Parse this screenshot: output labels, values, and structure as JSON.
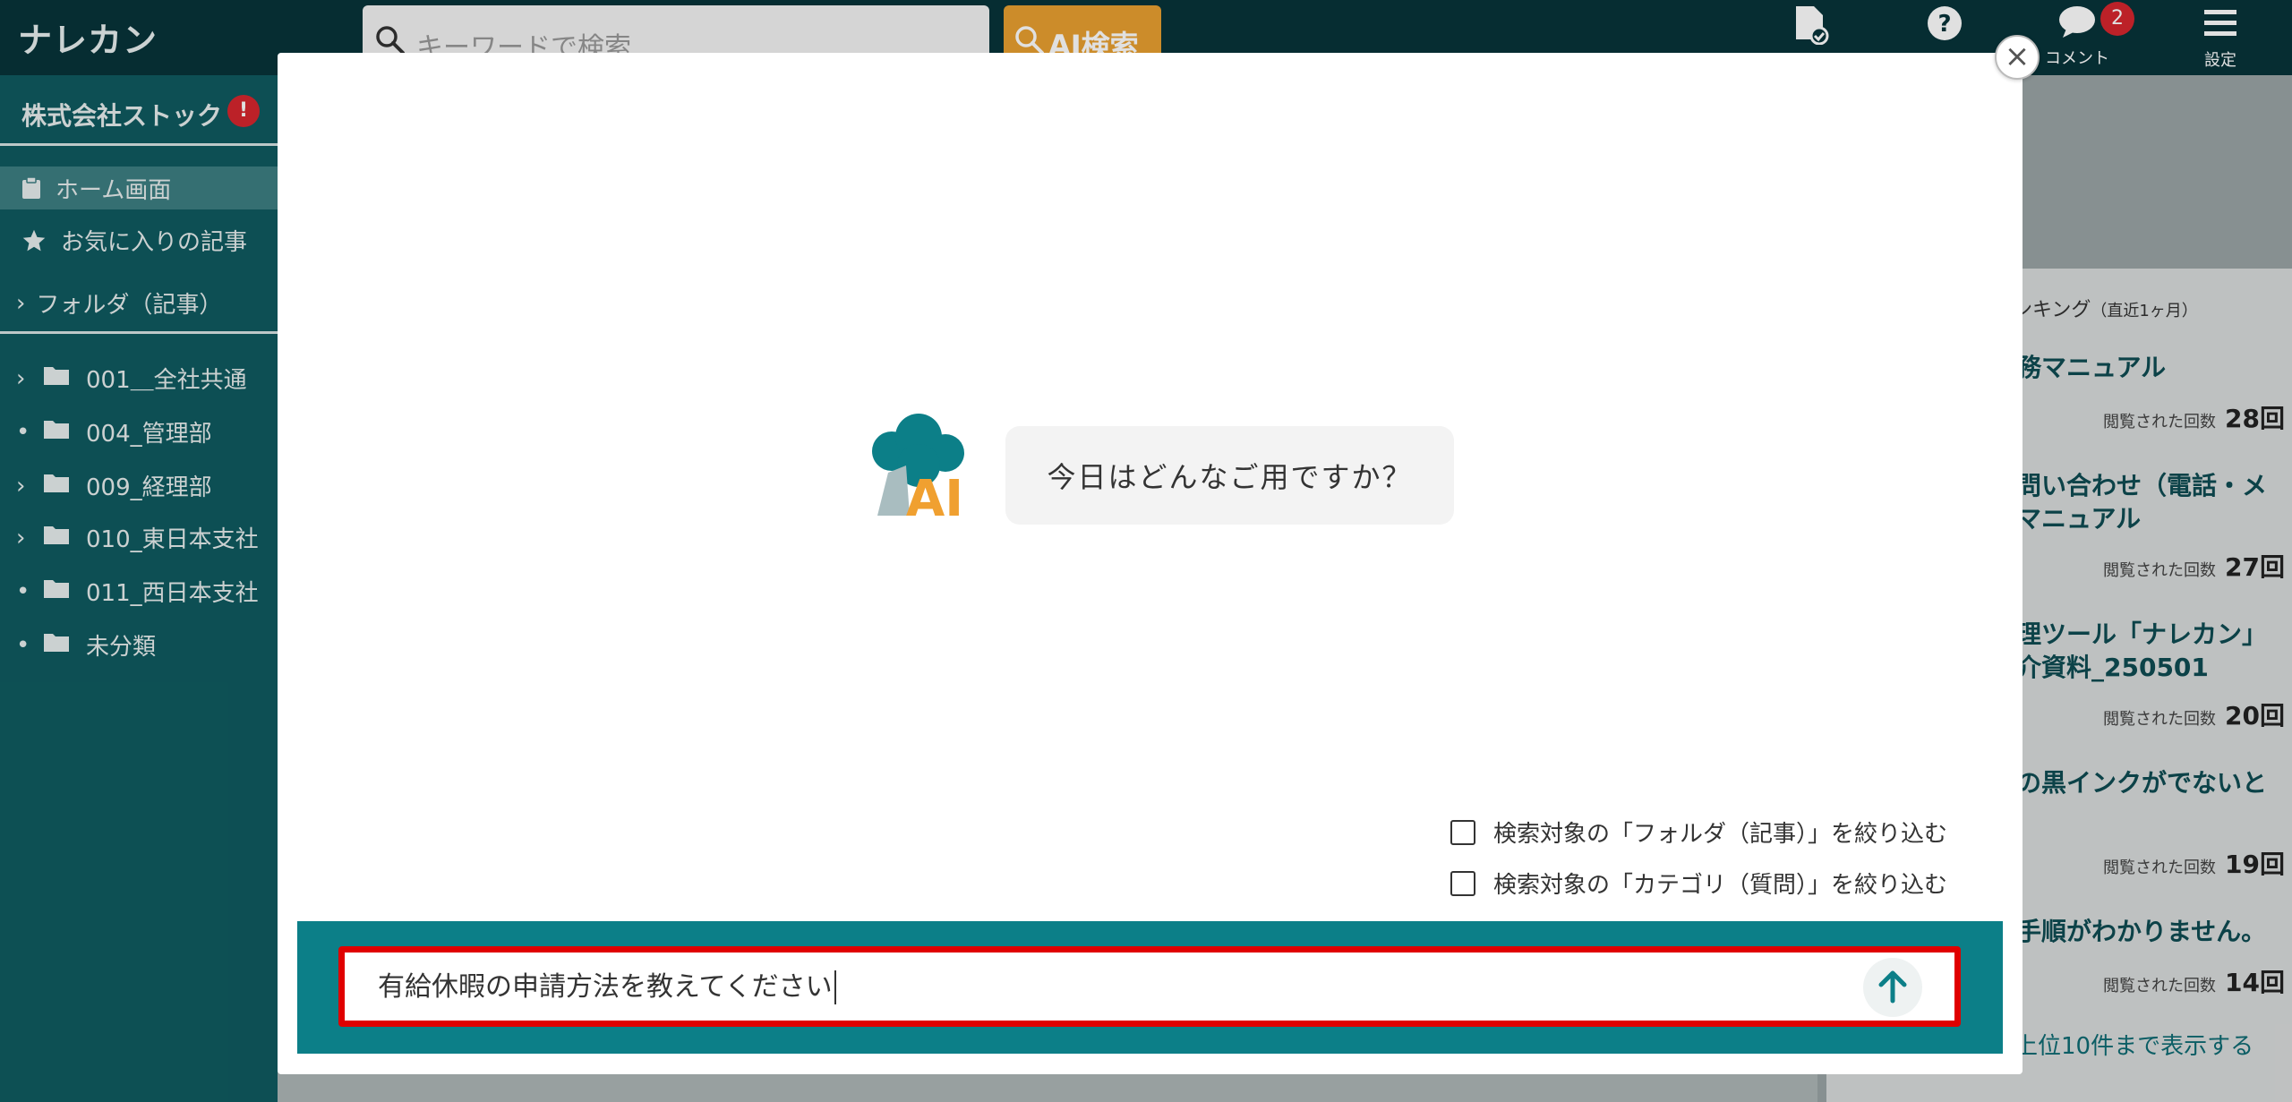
{
  "header": {
    "logo": "ナレカン",
    "search_placeholder": "キーワードで検索",
    "ai_search_label": "AI検索",
    "comment_label": "コメント",
    "comment_badge": "2",
    "settings_label": "設定"
  },
  "sidebar": {
    "company": "株式会社ストック",
    "company_alert": "!",
    "home": "ホーム画面",
    "favorites": "お気に入りの記事",
    "folder_section": "フォルダ（記事）",
    "folders": [
      {
        "label": "001＿全社共通",
        "expandable": true
      },
      {
        "label": "004_管理部",
        "expandable": false
      },
      {
        "label": "009_経理部",
        "expandable": true
      },
      {
        "label": "010_東日本支社",
        "expandable": true
      },
      {
        "label": "011_西日本支社",
        "expandable": false
      },
      {
        "label": "未分類",
        "expandable": false
      }
    ]
  },
  "ranking": {
    "title": "ンキング",
    "period": "（直近1ヶ月）",
    "view_label": "閲覧された回数",
    "items": [
      {
        "title": "務マニュアル",
        "count": "28回"
      },
      {
        "title": "問い合わせ（電話・メ マニュアル",
        "count": "27回"
      },
      {
        "title": "理ツール「ナレカン」 介資料_250501",
        "count": "20回"
      },
      {
        "title": "の黒インクがでないと",
        "count": "19回"
      },
      {
        "title": "手順がわかりません。",
        "count": "14回"
      }
    ],
    "more": "上位10件まで表示する"
  },
  "modal": {
    "close": "×",
    "ai_logo_text": "AI",
    "greeting": "今日はどんなご用ですか？",
    "filter_folder": "検索対象の「フォルダ（記事）」を絞り込む",
    "filter_category": "検索対象の「カテゴリ（質問）」を絞り込む",
    "input_value": "有給休暇の申請方法を教えてください"
  },
  "colors": {
    "topbar": "#07343a",
    "sidebar": "#0f5b60",
    "accent_teal": "#0c7f88",
    "ai_orange": "#e9a030",
    "highlight_red": "#e00000"
  }
}
